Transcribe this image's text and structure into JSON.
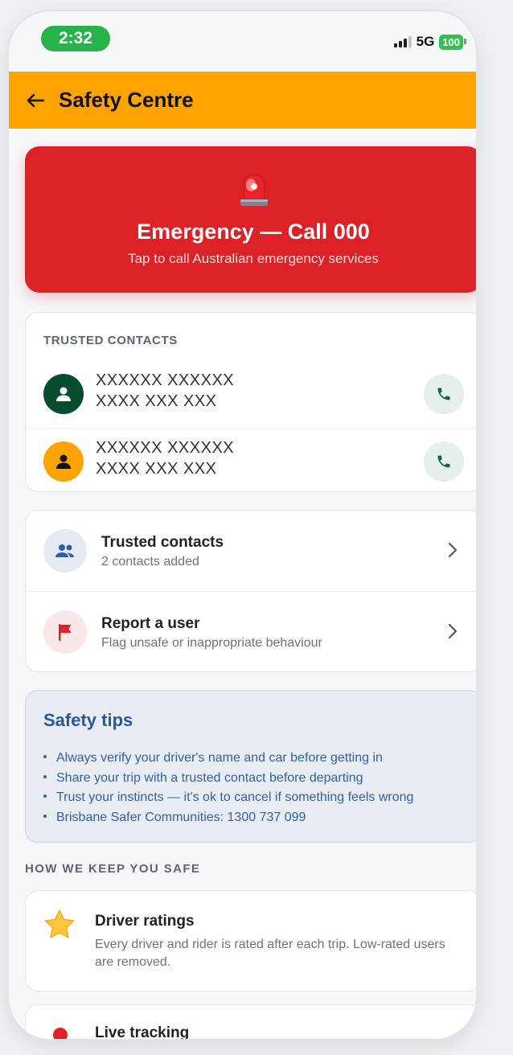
{
  "status": {
    "time": "2:32",
    "network": "5G",
    "battery": "100"
  },
  "header": {
    "title": "Safety Centre",
    "back_icon": "back-arrow-icon"
  },
  "emergency": {
    "title": "Emergency — Call 000",
    "subtitle": "Tap to call Australian emergency services",
    "icon": "siren-icon"
  },
  "trusted_contacts": {
    "section_label": "TRUSTED CONTACTS",
    "contacts": [
      {
        "name": "XXXXXX XXXXXX",
        "phone": "XXXX XXX XXX",
        "avatar_color": "#064d2e"
      },
      {
        "name": "XXXXXX XXXXXX",
        "phone": "XXXX XXX XXX",
        "avatar_color": "#ffa300"
      }
    ]
  },
  "menu": [
    {
      "title": "Trusted contacts",
      "subtitle": "2 contacts added",
      "icon": "people-icon"
    },
    {
      "title": "Report a user",
      "subtitle": "Flag unsafe or inappropriate behaviour",
      "icon": "flag-icon"
    }
  ],
  "tips": {
    "title": "Safety tips",
    "items": [
      "Always verify your driver's name and car before getting in",
      "Share your trip with a trusted contact before departing",
      "Trust your instincts — it's ok to cancel if something feels wrong",
      "Brisbane Safer Communities: 1300 737 099"
    ]
  },
  "how_we_keep_safe": {
    "section_label": "HOW WE KEEP YOU SAFE",
    "items": [
      {
        "title": "Driver ratings",
        "description": "Every driver and rider is rated after each trip. Low-rated users are removed.",
        "icon": "star-icon"
      },
      {
        "title": "Live tracking",
        "icon": "location-dot-icon"
      }
    ]
  },
  "colors": {
    "accent": "#ffa300",
    "emergency": "#dc2127",
    "tips_text": "#2b5797"
  }
}
